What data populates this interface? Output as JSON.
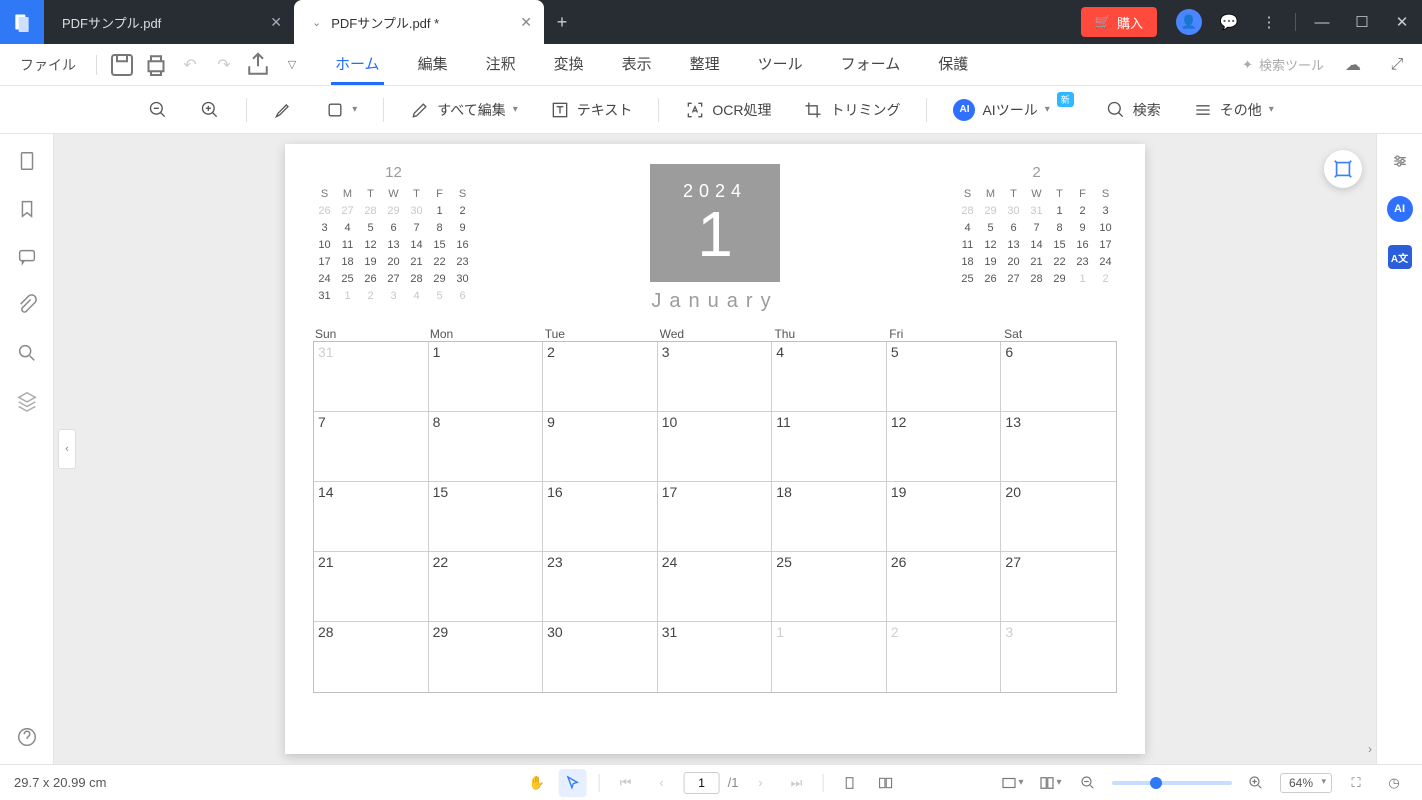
{
  "titlebar": {
    "tabs": [
      {
        "label": "PDFサンプル.pdf",
        "active": false
      },
      {
        "label": "PDFサンプル.pdf *",
        "active": true
      }
    ],
    "buy_label": "購入"
  },
  "menubar": {
    "file": "ファイル",
    "tabs": [
      "ホーム",
      "編集",
      "注釈",
      "変換",
      "表示",
      "整理",
      "ツール",
      "フォーム",
      "保護"
    ],
    "active_tab": 0,
    "search_tools": "検索ツール"
  },
  "toolbar": {
    "edit_all": "すべて編集",
    "text": "テキスト",
    "ocr": "OCR処理",
    "crop": "トリミング",
    "ai": "AIツール",
    "ai_new": "新",
    "search": "検索",
    "more": "その他"
  },
  "document": {
    "year": "2024",
    "month_num": "1",
    "month_name": "January",
    "week_heads": [
      "Sun",
      "Mon",
      "Tue",
      "Wed",
      "Thu",
      "Fri",
      "Sat"
    ],
    "mini_heads": [
      "S",
      "M",
      "T",
      "W",
      "T",
      "F",
      "S"
    ],
    "prev_mini": {
      "title": "12",
      "rows": [
        [
          "26",
          "27",
          "28",
          "29",
          "30",
          "1",
          "2"
        ],
        [
          "3",
          "4",
          "5",
          "6",
          "7",
          "8",
          "9"
        ],
        [
          "10",
          "11",
          "12",
          "13",
          "14",
          "15",
          "16"
        ],
        [
          "17",
          "18",
          "19",
          "20",
          "21",
          "22",
          "23"
        ],
        [
          "24",
          "25",
          "26",
          "27",
          "28",
          "29",
          "30"
        ],
        [
          "31",
          "1",
          "2",
          "3",
          "4",
          "5",
          "6"
        ]
      ],
      "dim_first": 5,
      "dim_last": 6
    },
    "next_mini": {
      "title": "2",
      "rows": [
        [
          "28",
          "29",
          "30",
          "31",
          "1",
          "2",
          "3"
        ],
        [
          "4",
          "5",
          "6",
          "7",
          "8",
          "9",
          "10"
        ],
        [
          "11",
          "12",
          "13",
          "14",
          "15",
          "16",
          "17"
        ],
        [
          "18",
          "19",
          "20",
          "21",
          "22",
          "23",
          "24"
        ],
        [
          "25",
          "26",
          "27",
          "28",
          "29",
          "1",
          "2"
        ]
      ],
      "dim_first": 4,
      "dim_last": 2
    },
    "main_cells": [
      {
        "n": "31",
        "dim": true
      },
      {
        "n": "1"
      },
      {
        "n": "2"
      },
      {
        "n": "3"
      },
      {
        "n": "4"
      },
      {
        "n": "5"
      },
      {
        "n": "6"
      },
      {
        "n": "7"
      },
      {
        "n": "8"
      },
      {
        "n": "9"
      },
      {
        "n": "10"
      },
      {
        "n": "11"
      },
      {
        "n": "12"
      },
      {
        "n": "13"
      },
      {
        "n": "14"
      },
      {
        "n": "15"
      },
      {
        "n": "16"
      },
      {
        "n": "17"
      },
      {
        "n": "18"
      },
      {
        "n": "19"
      },
      {
        "n": "20"
      },
      {
        "n": "21"
      },
      {
        "n": "22"
      },
      {
        "n": "23"
      },
      {
        "n": "24"
      },
      {
        "n": "25"
      },
      {
        "n": "26"
      },
      {
        "n": "27"
      },
      {
        "n": "28"
      },
      {
        "n": "29"
      },
      {
        "n": "30"
      },
      {
        "n": "31"
      },
      {
        "n": "1",
        "dim": true
      },
      {
        "n": "2",
        "dim": true
      },
      {
        "n": "3",
        "dim": true
      }
    ]
  },
  "statusbar": {
    "dimensions": "29.7 x 20.99 cm",
    "page_current": "1",
    "page_total": "/1",
    "zoom": "64%"
  }
}
